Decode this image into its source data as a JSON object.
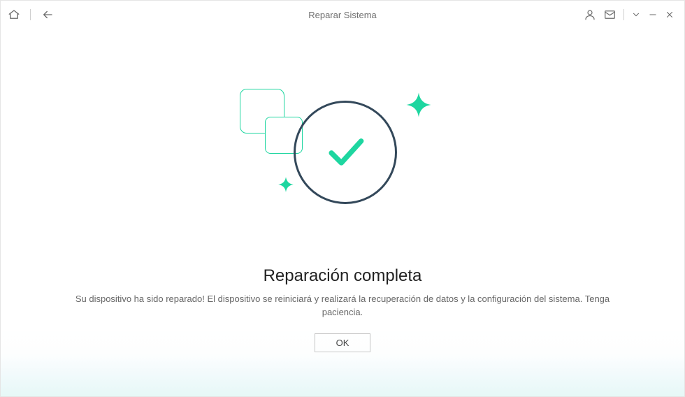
{
  "titlebar": {
    "title": "Reparar Sistema"
  },
  "main": {
    "heading": "Reparación completa",
    "description": "Su dispositivo ha sido reparado! El dispositivo se reiniciará y realizará la recuperación de datos y la configuración del sistema. Tenga paciencia.",
    "ok_label": "OK"
  }
}
